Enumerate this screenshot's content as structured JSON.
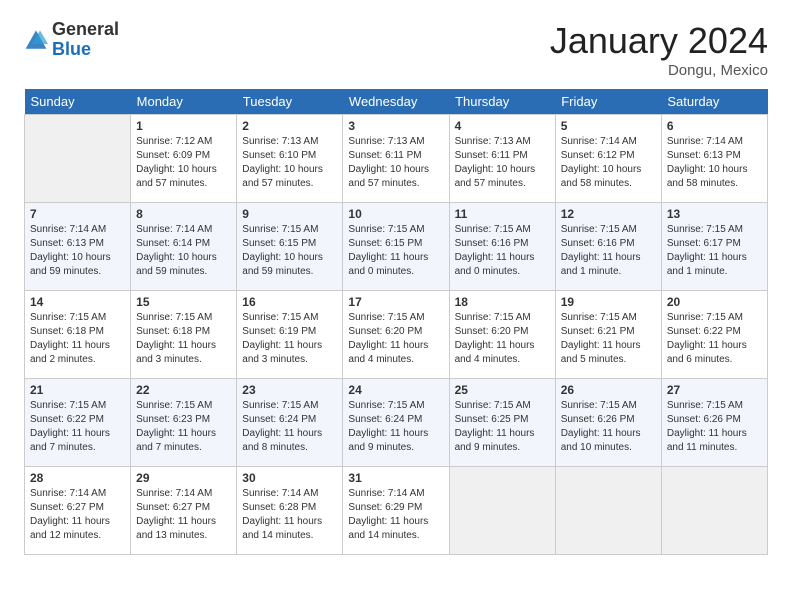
{
  "logo": {
    "general": "General",
    "blue": "Blue"
  },
  "header": {
    "title": "January 2024",
    "location": "Dongu, Mexico"
  },
  "days_of_week": [
    "Sunday",
    "Monday",
    "Tuesday",
    "Wednesday",
    "Thursday",
    "Friday",
    "Saturday"
  ],
  "weeks": [
    [
      {
        "num": "",
        "empty": true
      },
      {
        "num": "1",
        "sunrise": "7:12 AM",
        "sunset": "6:09 PM",
        "daylight": "10 hours and 57 minutes."
      },
      {
        "num": "2",
        "sunrise": "7:13 AM",
        "sunset": "6:10 PM",
        "daylight": "10 hours and 57 minutes."
      },
      {
        "num": "3",
        "sunrise": "7:13 AM",
        "sunset": "6:11 PM",
        "daylight": "10 hours and 57 minutes."
      },
      {
        "num": "4",
        "sunrise": "7:13 AM",
        "sunset": "6:11 PM",
        "daylight": "10 hours and 57 minutes."
      },
      {
        "num": "5",
        "sunrise": "7:14 AM",
        "sunset": "6:12 PM",
        "daylight": "10 hours and 58 minutes."
      },
      {
        "num": "6",
        "sunrise": "7:14 AM",
        "sunset": "6:13 PM",
        "daylight": "10 hours and 58 minutes."
      }
    ],
    [
      {
        "num": "7",
        "sunrise": "7:14 AM",
        "sunset": "6:13 PM",
        "daylight": "10 hours and 59 minutes."
      },
      {
        "num": "8",
        "sunrise": "7:14 AM",
        "sunset": "6:14 PM",
        "daylight": "10 hours and 59 minutes."
      },
      {
        "num": "9",
        "sunrise": "7:15 AM",
        "sunset": "6:15 PM",
        "daylight": "10 hours and 59 minutes."
      },
      {
        "num": "10",
        "sunrise": "7:15 AM",
        "sunset": "6:15 PM",
        "daylight": "11 hours and 0 minutes."
      },
      {
        "num": "11",
        "sunrise": "7:15 AM",
        "sunset": "6:16 PM",
        "daylight": "11 hours and 0 minutes."
      },
      {
        "num": "12",
        "sunrise": "7:15 AM",
        "sunset": "6:16 PM",
        "daylight": "11 hours and 1 minute."
      },
      {
        "num": "13",
        "sunrise": "7:15 AM",
        "sunset": "6:17 PM",
        "daylight": "11 hours and 1 minute."
      }
    ],
    [
      {
        "num": "14",
        "sunrise": "7:15 AM",
        "sunset": "6:18 PM",
        "daylight": "11 hours and 2 minutes."
      },
      {
        "num": "15",
        "sunrise": "7:15 AM",
        "sunset": "6:18 PM",
        "daylight": "11 hours and 3 minutes."
      },
      {
        "num": "16",
        "sunrise": "7:15 AM",
        "sunset": "6:19 PM",
        "daylight": "11 hours and 3 minutes."
      },
      {
        "num": "17",
        "sunrise": "7:15 AM",
        "sunset": "6:20 PM",
        "daylight": "11 hours and 4 minutes."
      },
      {
        "num": "18",
        "sunrise": "7:15 AM",
        "sunset": "6:20 PM",
        "daylight": "11 hours and 4 minutes."
      },
      {
        "num": "19",
        "sunrise": "7:15 AM",
        "sunset": "6:21 PM",
        "daylight": "11 hours and 5 minutes."
      },
      {
        "num": "20",
        "sunrise": "7:15 AM",
        "sunset": "6:22 PM",
        "daylight": "11 hours and 6 minutes."
      }
    ],
    [
      {
        "num": "21",
        "sunrise": "7:15 AM",
        "sunset": "6:22 PM",
        "daylight": "11 hours and 7 minutes."
      },
      {
        "num": "22",
        "sunrise": "7:15 AM",
        "sunset": "6:23 PM",
        "daylight": "11 hours and 7 minutes."
      },
      {
        "num": "23",
        "sunrise": "7:15 AM",
        "sunset": "6:24 PM",
        "daylight": "11 hours and 8 minutes."
      },
      {
        "num": "24",
        "sunrise": "7:15 AM",
        "sunset": "6:24 PM",
        "daylight": "11 hours and 9 minutes."
      },
      {
        "num": "25",
        "sunrise": "7:15 AM",
        "sunset": "6:25 PM",
        "daylight": "11 hours and 9 minutes."
      },
      {
        "num": "26",
        "sunrise": "7:15 AM",
        "sunset": "6:26 PM",
        "daylight": "11 hours and 10 minutes."
      },
      {
        "num": "27",
        "sunrise": "7:15 AM",
        "sunset": "6:26 PM",
        "daylight": "11 hours and 11 minutes."
      }
    ],
    [
      {
        "num": "28",
        "sunrise": "7:14 AM",
        "sunset": "6:27 PM",
        "daylight": "11 hours and 12 minutes."
      },
      {
        "num": "29",
        "sunrise": "7:14 AM",
        "sunset": "6:27 PM",
        "daylight": "11 hours and 13 minutes."
      },
      {
        "num": "30",
        "sunrise": "7:14 AM",
        "sunset": "6:28 PM",
        "daylight": "11 hours and 14 minutes."
      },
      {
        "num": "31",
        "sunrise": "7:14 AM",
        "sunset": "6:29 PM",
        "daylight": "11 hours and 14 minutes."
      },
      {
        "num": "",
        "empty": true
      },
      {
        "num": "",
        "empty": true
      },
      {
        "num": "",
        "empty": true
      }
    ]
  ]
}
